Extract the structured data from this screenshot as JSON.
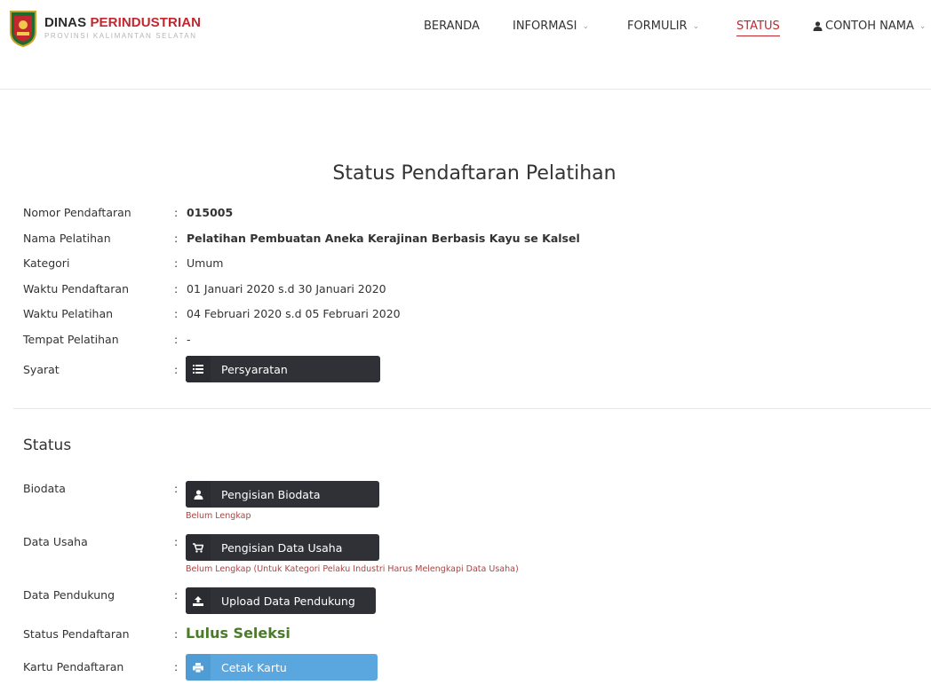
{
  "brand": {
    "title_part1": "DINAS ",
    "title_part2": "PERINDUSTRIAN",
    "subtitle": "PROVINSI KALIMANTAN SELATAN"
  },
  "nav": {
    "items": [
      {
        "label": "BERANDA"
      },
      {
        "label": "INFORMASI"
      },
      {
        "label": "FORMULIR"
      },
      {
        "label": "STATUS"
      },
      {
        "label": "CONTOH NAMA"
      }
    ]
  },
  "page_title": "Status Pendaftaran Pelatihan",
  "info": {
    "colon": ":",
    "rows": [
      {
        "label": "Nomor Pendaftaran",
        "value": "015005"
      },
      {
        "label": "Nama Pelatihan",
        "value": "Pelatihan Pembuatan Aneka Kerajinan Berbasis Kayu se Kalsel"
      },
      {
        "label": "Kategori",
        "value": "Umum"
      },
      {
        "label": "Waktu Pendaftaran",
        "value": "01 Januari 2020 s.d 30 Januari 2020"
      },
      {
        "label": "Waktu Pelatihan",
        "value": "04 Februari 2020 s.d 05 Februari 2020"
      },
      {
        "label": "Tempat Pelatihan",
        "value": "-"
      },
      {
        "label": "Syarat",
        "button": "Persyaratan"
      }
    ]
  },
  "status": {
    "title": "Status",
    "biodata": {
      "label": "Biodata",
      "button": "Pengisian Biodata",
      "note": "Belum Lengkap"
    },
    "data_usaha": {
      "label": "Data Usaha",
      "button": "Pengisian Data Usaha",
      "note": "Belum Lengkap (Untuk Kategori Pelaku Industri Harus Melengkapi Data Usaha)"
    },
    "data_pendukung": {
      "label": "Data Pendukung",
      "button": "Upload Data Pendukung"
    },
    "status_pendaftaran": {
      "label": "Status Pendaftaran",
      "value": "Lulus Seleksi"
    },
    "kartu": {
      "label": "Kartu Pendaftaran",
      "button": "Cetak Kartu"
    }
  },
  "colors": {
    "brand_red": "#c1272d",
    "dark_button": "#2f3137",
    "blue_button": "#5aa6df",
    "status_green": "#4b7a2b",
    "note_red": "#a94442"
  },
  "icons": {
    "logo": "kalsel-emblem",
    "list": "list-icon",
    "user": "user-icon",
    "cart": "cart-icon",
    "upload": "upload-icon",
    "print": "print-icon",
    "chevron": "chevron-down-icon"
  }
}
